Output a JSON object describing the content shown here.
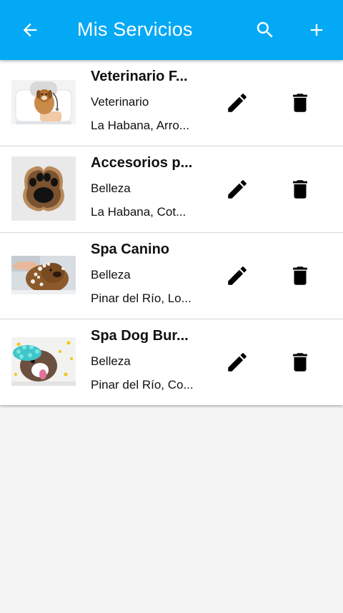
{
  "appbar": {
    "title": "Mis Servicios",
    "back_icon": "arrow-left-icon",
    "search_icon": "search-icon",
    "add_icon": "plus-icon",
    "color": "#03a9f4"
  },
  "services": [
    {
      "name": "Veterinario F...",
      "category": "Veterinario",
      "location": "La Habana, Arro...",
      "image": "vet-with-puppy"
    },
    {
      "name": "Accesorios p...",
      "category": "Belleza",
      "location": "La Habana, Cot...",
      "image": "paw-cushion"
    },
    {
      "name": "Spa Canino",
      "category": "Belleza",
      "location": "Pinar del Río, Lo...",
      "image": "dog-bath"
    },
    {
      "name": "Spa Dog Bur...",
      "category": "Belleza",
      "location": "Pinar del Río, Co...",
      "image": "dog-shower-cap"
    }
  ],
  "row_actions": {
    "edit_icon": "pencil-icon",
    "delete_icon": "trash-icon"
  }
}
